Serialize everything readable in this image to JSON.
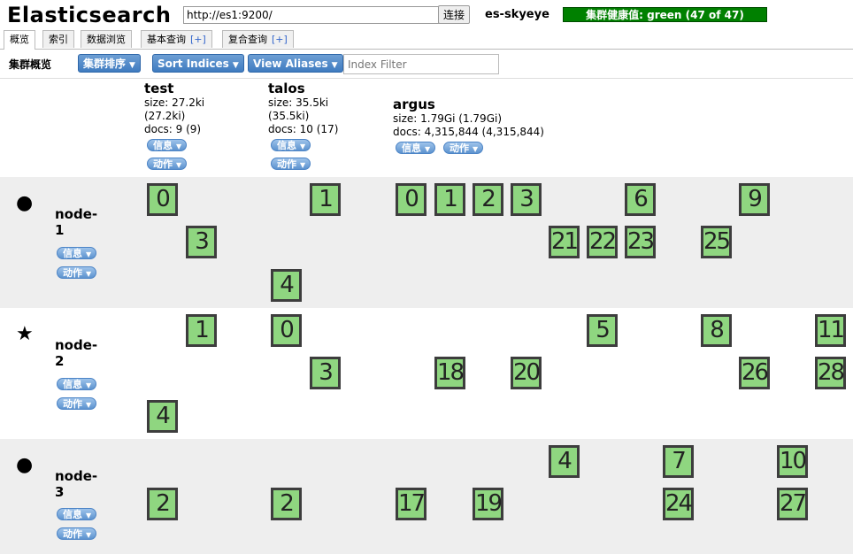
{
  "header": {
    "logo": "Elasticsearch",
    "url_value": "http://es1:9200/",
    "connect_label": "连接",
    "cluster_name": "es-skyeye",
    "health_text": "集群健康值: green (47 of 47)",
    "health_color": "#008000"
  },
  "tabs": [
    {
      "label": "概览",
      "plus": ""
    },
    {
      "label": "索引",
      "plus": ""
    },
    {
      "label": "数据浏览",
      "plus": ""
    },
    {
      "label": "基本查询",
      "plus": "[+]"
    },
    {
      "label": "复合查询",
      "plus": "[+]"
    }
  ],
  "toolbar": {
    "title": "集群概览",
    "sort_label": "集群排序",
    "sort_indices_label": "Sort Indices",
    "view_aliases_label": "View Aliases",
    "filter_placeholder": "Index Filter"
  },
  "index_buttons": {
    "info": "信息",
    "action": "动作"
  },
  "indices": [
    {
      "name": "test",
      "size": "size: 27.2ki",
      "size2": "(27.2ki)",
      "docs": "docs: 9 (9)"
    },
    {
      "name": "talos",
      "size": "size: 35.5ki",
      "size2": "(35.5ki)",
      "docs": "docs: 10 (17)"
    },
    {
      "name": "argus",
      "size": "size: 1.79Gi (1.79Gi)",
      "size2": "",
      "docs": "docs: 4,315,844 (4,315,844)"
    }
  ],
  "nodes": [
    {
      "icon": "●",
      "icon_name": "circle-icon",
      "name_line1": "node-",
      "name_line2": "1"
    },
    {
      "icon": "★",
      "icon_name": "star-icon",
      "name_line1": "node-",
      "name_line2": "2"
    },
    {
      "icon": "●",
      "icon_name": "circle-icon",
      "name_line1": "node-",
      "name_line2": "3"
    }
  ],
  "node_buttons": {
    "info": "信息",
    "action": "动作"
  },
  "shards": {
    "node1": {
      "test": [
        "0",
        "3"
      ],
      "talos": [
        "1",
        "4"
      ],
      "argus": [
        "0",
        "1",
        "2",
        "3",
        "6",
        "9",
        "21",
        "22",
        "23",
        "25"
      ]
    },
    "node2": {
      "test": [
        "1",
        "4"
      ],
      "talos": [
        "0",
        "3"
      ],
      "argus": [
        "5",
        "8",
        "11",
        "18",
        "20",
        "26",
        "28"
      ]
    },
    "node3": {
      "test": [
        "2"
      ],
      "talos": [
        "2"
      ],
      "argus": [
        "4",
        "7",
        "10",
        "17",
        "19",
        "24",
        "27"
      ]
    }
  },
  "colors": {
    "shard_fill": "#8fd680",
    "shard_border": "#3d3d3d",
    "row_alt": "#eeeeee"
  }
}
